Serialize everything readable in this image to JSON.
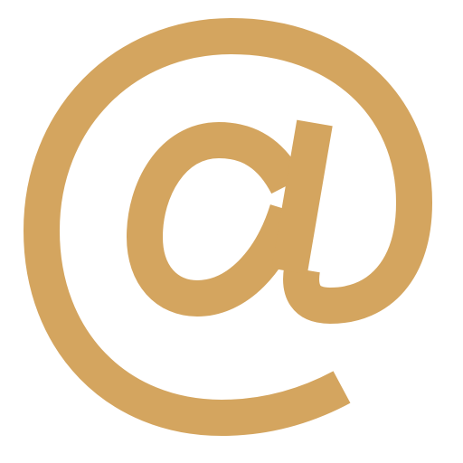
{
  "icon": {
    "name": "at-sign-icon",
    "color": "#D4A55F",
    "background": "#FFFFFF"
  }
}
